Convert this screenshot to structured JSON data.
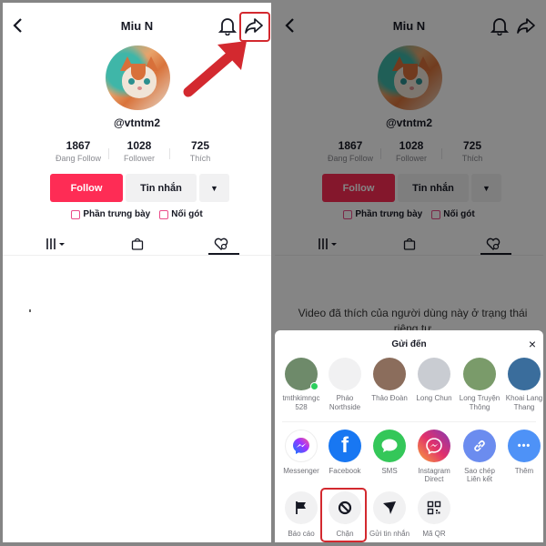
{
  "profile": {
    "title": "Miu N",
    "username": "@vtntm2",
    "stats": [
      {
        "value": "1867",
        "label": "Đang Follow"
      },
      {
        "value": "1028",
        "label": "Follower"
      },
      {
        "value": "725",
        "label": "Thích"
      }
    ],
    "buttons": {
      "follow": "Follow",
      "message": "Tin nhắn",
      "more": "▼"
    },
    "links": [
      {
        "label": "Phần trưng bày",
        "icon": "showcase-bag-icon"
      },
      {
        "label": "Nối gót",
        "icon": "camera-icon"
      }
    ],
    "tabs": [
      {
        "icon": "videos-grid-icon",
        "active": false
      },
      {
        "icon": "shop-bag-icon",
        "active": false
      },
      {
        "icon": "liked-videos-icon",
        "active": true
      }
    ]
  },
  "private_message": "Video đã thích của người dùng này ở trạng thái riêng tư",
  "share_sheet": {
    "title": "Gửi đến",
    "close": "×",
    "contacts": [
      {
        "name": "tmthkimngc 528",
        "online": true,
        "color": "#6e8a6a"
      },
      {
        "name": "Pháo Northside",
        "online": false,
        "color": "#f1f1f2"
      },
      {
        "name": "Thảo Đoàn",
        "online": false,
        "color": "#8b6d5c"
      },
      {
        "name": "Long Chun",
        "online": false,
        "color": "#c9ccd2"
      },
      {
        "name": "Long Truyện Thông",
        "online": false,
        "color": "#7a9b6a"
      },
      {
        "name": "Khoai Lang Thang",
        "online": false,
        "color": "#3a6d9c"
      }
    ],
    "apps": [
      {
        "label": "Messenger",
        "icon": "messenger-icon",
        "bg": "#ffffff",
        "glyph": "~"
      },
      {
        "label": "Facebook",
        "icon": "facebook-icon",
        "bg": "#1877f2",
        "glyph": "f"
      },
      {
        "label": "SMS",
        "icon": "sms-icon",
        "bg": "#34c759",
        "glyph": "💬"
      },
      {
        "label": "Instagram Direct",
        "icon": "instagram-direct-icon",
        "bg": "#d6249f",
        "glyph": "~"
      },
      {
        "label": "Sao chép Liên kết",
        "icon": "copy-link-icon",
        "bg": "#6b8cef",
        "glyph": "🔗"
      },
      {
        "label": "Thêm",
        "icon": "more-dots-icon",
        "bg": "#4e92f7",
        "glyph": "•••"
      }
    ],
    "actions": [
      {
        "label": "Báo cáo",
        "icon": "flag-icon"
      },
      {
        "label": "Chặn",
        "icon": "block-icon"
      },
      {
        "label": "Gửi tin nhắn",
        "icon": "send-message-icon"
      },
      {
        "label": "Mã QR",
        "icon": "qr-code-icon"
      }
    ]
  },
  "colors": {
    "accent": "#fe2c55",
    "highlight": "#d3292f"
  }
}
